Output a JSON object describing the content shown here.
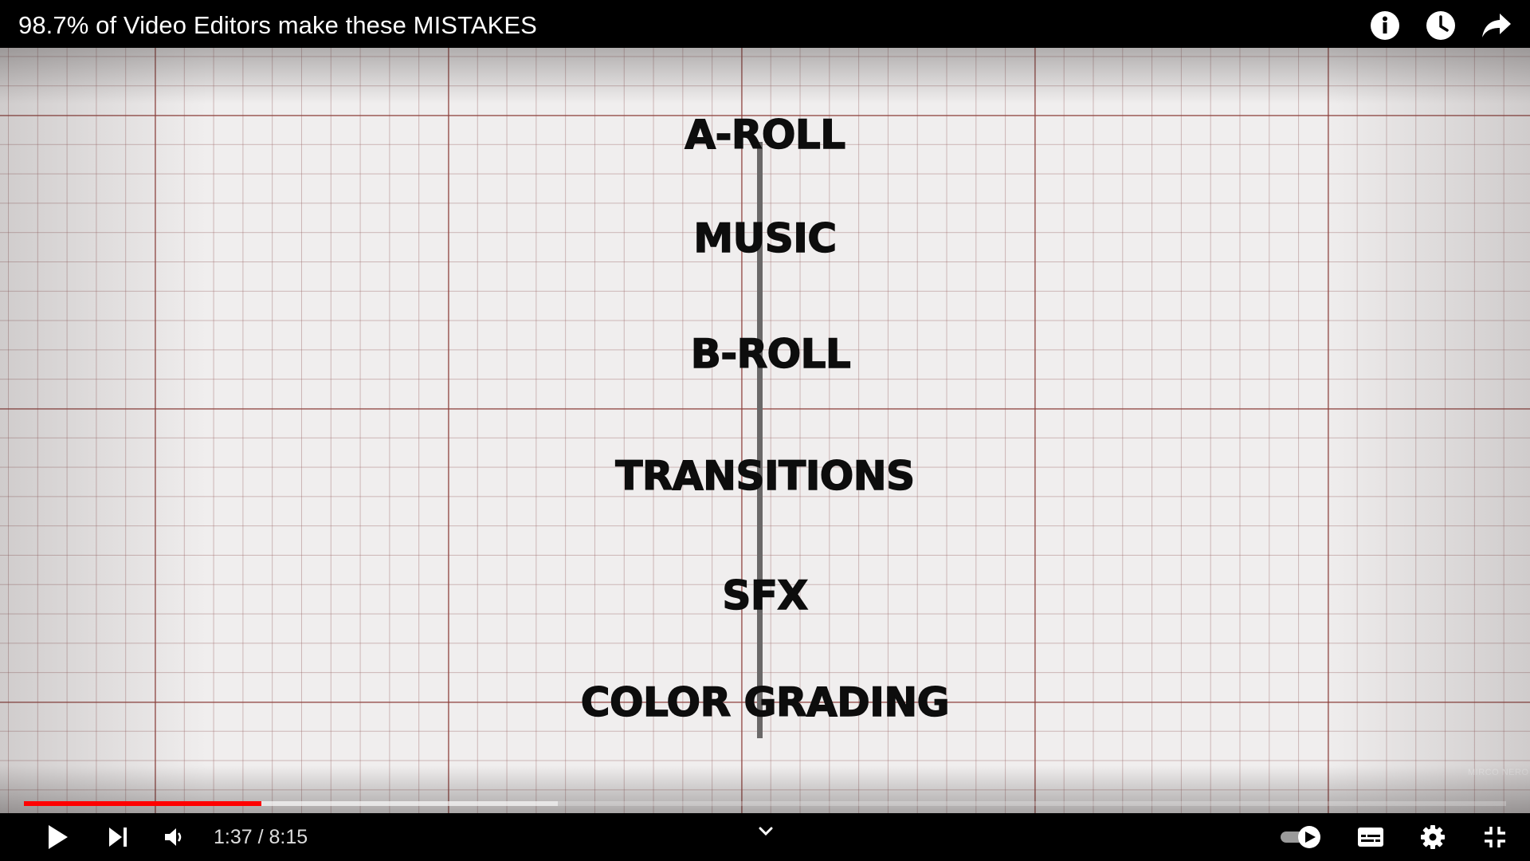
{
  "video": {
    "title": "98.7% of Video Editors make these MISTAKES",
    "watermark": "MIRCO NERO"
  },
  "top_actions": [
    {
      "name": "info-icon"
    },
    {
      "name": "watch-later-icon"
    },
    {
      "name": "share-icon"
    }
  ],
  "frame": {
    "tracks": [
      "A-ROLL",
      "MUSIC",
      "B-ROLL",
      "TRANSITIONS",
      "SFX",
      "COLOR GRADING"
    ]
  },
  "player": {
    "time_display": "1:37 / 8:15",
    "progress_played": 0.16,
    "progress_buffered": 0.36,
    "accent_color": "#ff0000"
  }
}
